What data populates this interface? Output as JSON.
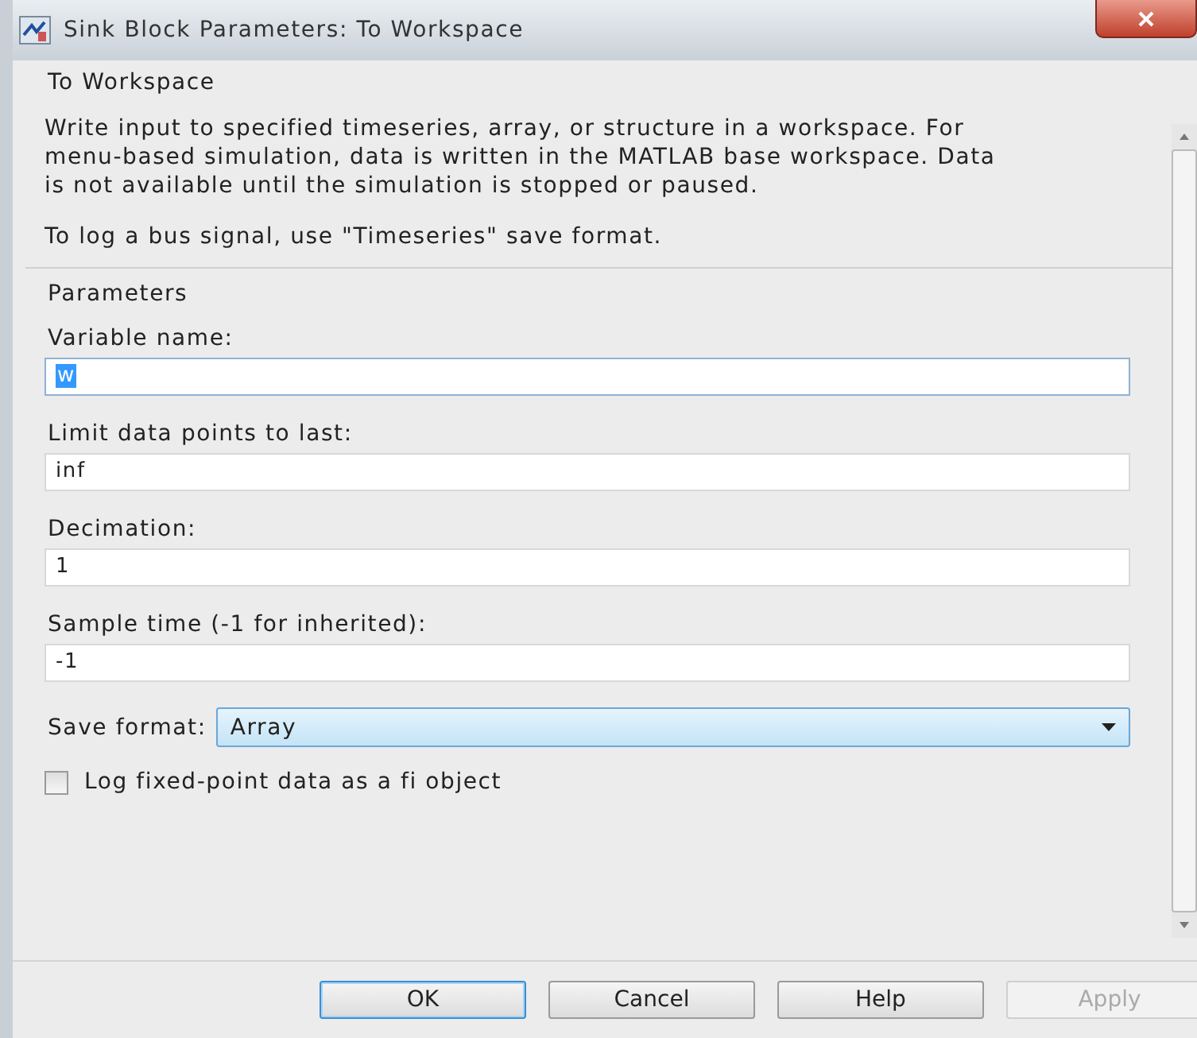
{
  "window": {
    "title": "Sink Block Parameters: To Workspace"
  },
  "block_name": "To Workspace",
  "description": [
    "Write input to specified timeseries, array, or structure in a workspace. For menu-based simulation, data is written in the MATLAB base workspace. Data is not available until the simulation is stopped or paused.",
    "To log a bus signal, use \"Timeseries\" save format."
  ],
  "section_title": "Parameters",
  "fields": [
    {
      "kind": "text",
      "label": "Variable name:",
      "value": "w",
      "focused": true
    },
    {
      "kind": "text",
      "label": "Limit data points to last:",
      "value": "inf",
      "focused": false
    },
    {
      "kind": "text",
      "label": "Decimation:",
      "value": "1",
      "focused": false
    },
    {
      "kind": "text",
      "label": "Sample time (-1 for inherited):",
      "value": "-1",
      "focused": false
    },
    {
      "kind": "dropdown",
      "label": "Save format:",
      "value": "Array",
      "focused": false
    },
    {
      "kind": "checkbox",
      "label": "Log fixed-point data as a fi object",
      "checked": false
    }
  ],
  "buttons": [
    {
      "label": "OK",
      "default": true,
      "disabled": false
    },
    {
      "label": "Cancel",
      "default": false,
      "disabled": false
    },
    {
      "label": "Help",
      "default": false,
      "disabled": false
    },
    {
      "label": "Apply",
      "default": false,
      "disabled": true
    }
  ]
}
